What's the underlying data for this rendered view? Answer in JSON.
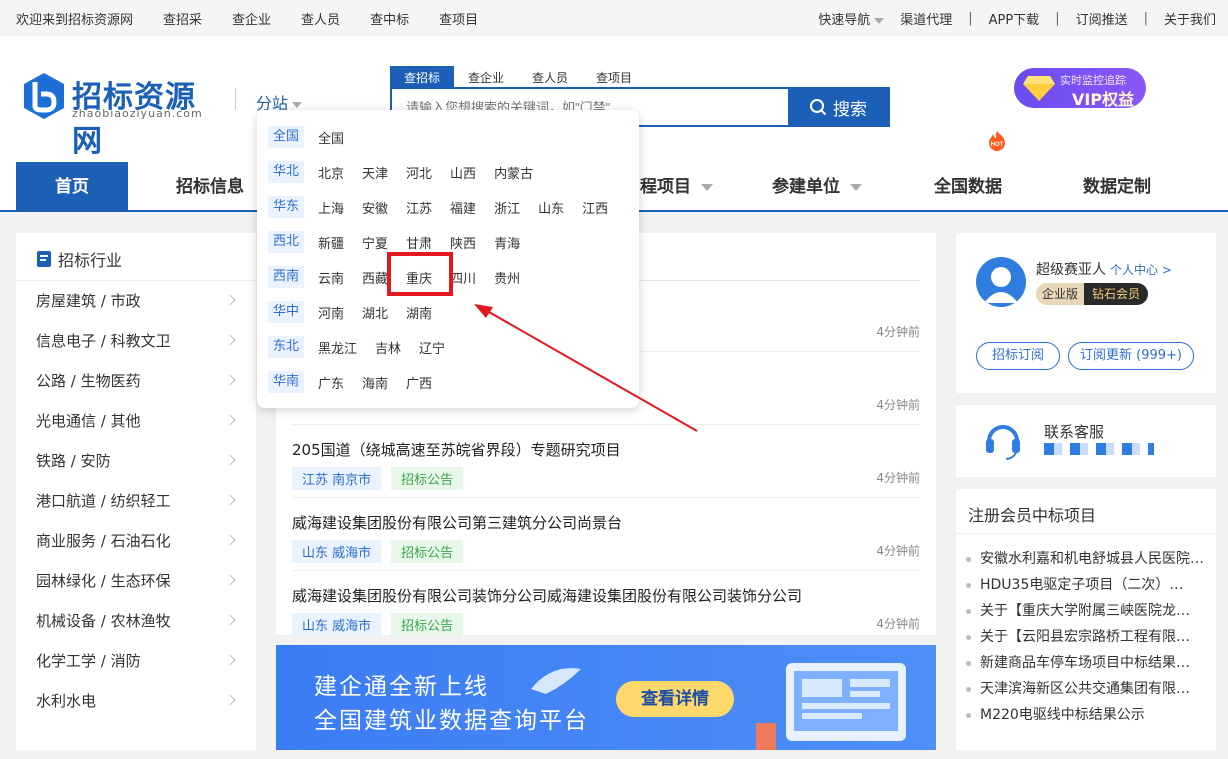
{
  "topbar": {
    "left": [
      "欢迎来到招标资源网",
      "查招采",
      "查企业",
      "查人员",
      "查中标",
      "查项目"
    ],
    "quick_nav": "快速导航",
    "right": [
      "渠道代理",
      "APP下载",
      "订阅推送",
      "关于我们"
    ],
    "sep": "|"
  },
  "header": {
    "logo_text": "招标资源网",
    "logo_sub": "zhaobiaoziyuan.com",
    "branch": "分站",
    "search_tabs": [
      "查招标",
      "查企业",
      "查人员",
      "查项目"
    ],
    "search_placeholder": "请输入您想搜索的关键词，如\"门禁\"",
    "search_button": "搜索",
    "vip_small": "实时监控追踪",
    "vip_big": "VIP权益"
  },
  "nav": {
    "home": "首页",
    "bid_info": "招标信息",
    "project": "程项目",
    "builders": "参建单位",
    "national_data": "全国数据",
    "hot": "HOT",
    "custom": "数据定制"
  },
  "sidebar": {
    "title": "招标行业",
    "items": [
      "房屋建筑 / 市政",
      "信息电子 / 科教文卫",
      "公路 / 生物医药",
      "光电通信 / 其他",
      "铁路 / 安防",
      "港口航道 / 纺织轻工",
      "商业服务 / 石油石化",
      "园林绿化 / 生态环保",
      "机械设备 / 农林渔牧",
      "化学工学 / 消防",
      "水利水电"
    ]
  },
  "dropdown": {
    "rows": [
      {
        "region": "全国",
        "cities": [
          "全国"
        ]
      },
      {
        "region": "华北",
        "cities": [
          "北京",
          "天津",
          "河北",
          "山西",
          "内蒙古"
        ]
      },
      {
        "region": "华东",
        "cities": [
          "上海",
          "安徽",
          "江苏",
          "福建",
          "浙江",
          "山东",
          "江西"
        ]
      },
      {
        "region": "西北",
        "cities": [
          "新疆",
          "宁夏",
          "甘肃",
          "陕西",
          "青海"
        ]
      },
      {
        "region": "西南",
        "cities": [
          "云南",
          "西藏",
          "重庆",
          "四川",
          "贵州"
        ]
      },
      {
        "region": "华中",
        "cities": [
          "河南",
          "湖北",
          "湖南"
        ]
      },
      {
        "region": "东北",
        "cities": [
          "黑龙江",
          "吉林",
          "辽宁"
        ]
      },
      {
        "region": "华南",
        "cities": [
          "广东",
          "海南",
          "广西"
        ]
      }
    ]
  },
  "listing": {
    "times": [
      "4分钟前",
      "4分钟前"
    ],
    "items": [
      {
        "title": "205国道（绕城高速至苏皖省界段）专题研究项目",
        "loc": "江苏 南京市",
        "kind": "招标公告",
        "time": "4分钟前"
      },
      {
        "title": "威海建设集团股份有限公司第三建筑分公司尚景台",
        "loc": "山东 威海市",
        "kind": "招标公告",
        "time": "4分钟前"
      },
      {
        "title": "威海建设集团股份有限公司装饰分公司威海建设集团股份有限公司装饰分公司",
        "loc": "山东 威海市",
        "kind": "招标公告",
        "time": "4分钟前"
      }
    ]
  },
  "banner": {
    "line1": "建企通全新上线",
    "line2": "全国建筑业数据查询平台",
    "button": "查看详情"
  },
  "user": {
    "name": "超级赛亚人",
    "center": "个人中心 >",
    "edition": "企业版",
    "level": "钻石会员",
    "btn1": "招标订阅",
    "btn2": "订阅更新 (999+)"
  },
  "cs": {
    "title": "联系客服"
  },
  "registered": {
    "title": "注册会员中标项目",
    "items": [
      "安徽水利嘉和机电舒城县人民医院…",
      "HDU35电驱定子项目（二次）…",
      "关于【重庆大学附属三峡医院龙…",
      "关于【云阳县宏宗路桥工程有限…",
      "新建商品车停车场项目中标结果…",
      "天津滨海新区公共交通集团有限…",
      "M220电驱线中标结果公示"
    ]
  },
  "colors": {
    "brand": "#1b5fb6",
    "highlight": "#e4161e"
  }
}
